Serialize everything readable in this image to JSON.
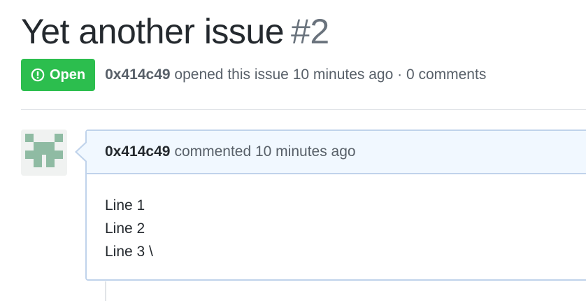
{
  "issue": {
    "title": "Yet another issue",
    "number": "#2",
    "state": "Open",
    "state_icon": "issue-opened-icon",
    "author": "0x414c49",
    "opened_text": "opened this issue 10 minutes ago · 0 comments"
  },
  "colors": {
    "state_open": "#2cbe4e",
    "comment_header_bg": "#f1f8ff",
    "comment_border": "#c0d3eb",
    "avatar": "#8fbba3"
  },
  "comment": {
    "author": "0x414c49",
    "action_text": "commented 10 minutes ago",
    "lines": [
      "Line 1",
      "Line 2",
      "Line 3 \\"
    ]
  }
}
